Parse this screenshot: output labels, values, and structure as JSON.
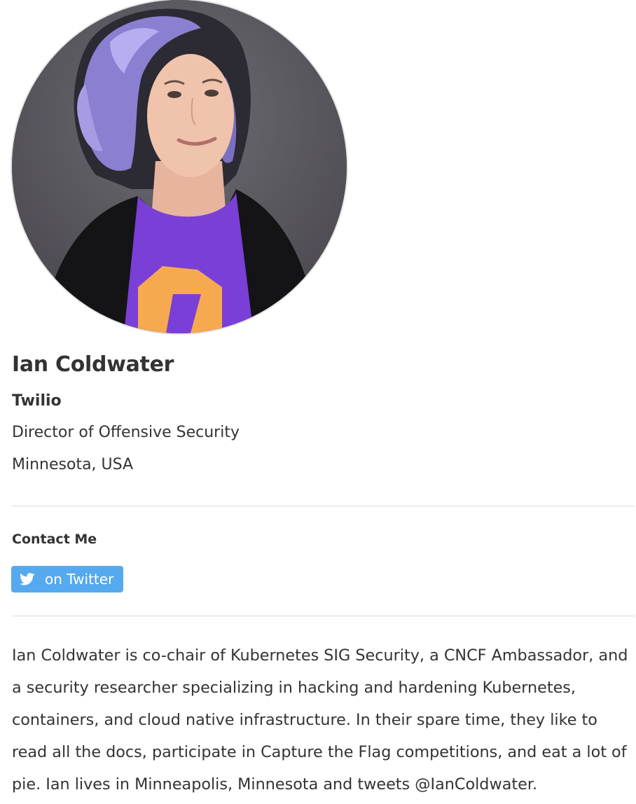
{
  "profile": {
    "name": "Ian Coldwater",
    "company": "Twilio",
    "title": "Director of Offensive Security",
    "location": "Minnesota, USA"
  },
  "contact": {
    "heading": "Contact Me",
    "twitter_label": "on Twitter",
    "twitter_icon": "twitter-bird-icon"
  },
  "bio": "Ian Coldwater is co-chair of Kubernetes SIG Security, a CNCF Ambassador, and a security researcher specializing in hacking and hardening Kubernetes, containers, and cloud native infrastructure. In their spare time, they like to read all the docs, participate in Capture the Flag competitions, and eat a lot of pie. Ian lives in Minneapolis, Minnesota and tweets @IanColdwater.",
  "colors": {
    "twitter_button": "#55a9ee",
    "text": "#333333",
    "divider": "#dcdcdc"
  }
}
